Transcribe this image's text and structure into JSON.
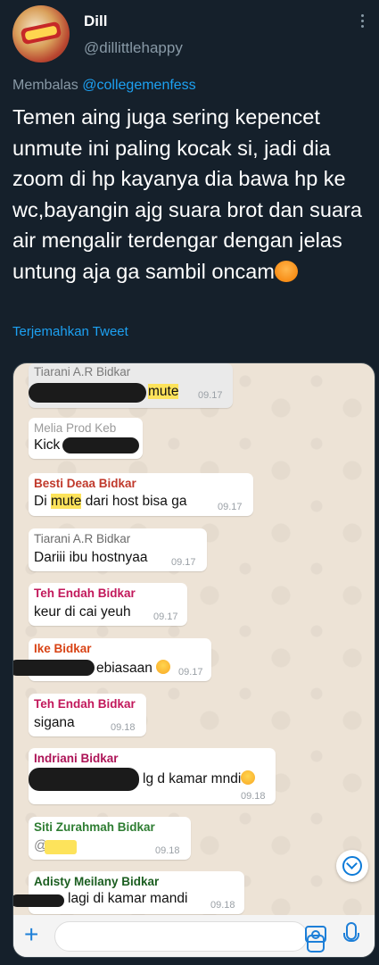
{
  "author": {
    "name": "Dill",
    "handle": "@dillittlehappy"
  },
  "reply": {
    "prefix": "Membalas",
    "mention": "@collegemenfess"
  },
  "tweet": {
    "text": "Temen aing juga sering kepencet unmute ini paling kocak si, jadi dia zoom di hp kayanya dia bawa hp ke wc,bayangin ajg suara brot dan suara air mengalir terdengar dengan jelas untung aja ga sambil oncam",
    "emoji": "tired-face-emoji"
  },
  "translate_label": "Terjemahkan Tweet",
  "chat": {
    "messages": [
      {
        "sender": "Tiarani A.R Bidkar",
        "sender_color": "#7a7a7a",
        "text": "mute",
        "time": "09.17"
      },
      {
        "sender": "Melia Prod Keb",
        "sender_color": "#9a9a9a",
        "text": "Kick",
        "time": ""
      },
      {
        "sender": "Besti Deaa Bidkar",
        "sender_color": "#c0392b",
        "text_before": "Di ",
        "text_hl": "mute",
        "text_after": " dari host bisa ga",
        "time": "09.17"
      },
      {
        "sender": "Tiarani A.R Bidkar",
        "sender_color": "#6b6b6b",
        "text": "Dariii ibu hostnyaa",
        "time": "09.17"
      },
      {
        "sender": "Teh Endah Bidkar",
        "sender_color": "#c2185b",
        "text": "keur di cai yeuh",
        "time": "09.17"
      },
      {
        "sender": "Ike Bidkar",
        "sender_color": "#d84315",
        "text": "ebiasaan",
        "time": "09.17"
      },
      {
        "sender": "Teh Endah Bidkar",
        "sender_color": "#c2185b",
        "text": "sigana",
        "time": "09.18"
      },
      {
        "sender": "Indriani Bidkar",
        "sender_color": "#ad1457",
        "text": "lg d kamar mndi",
        "time": "09.18"
      },
      {
        "sender": "Siti Zurahmah Bidkar",
        "sender_color": "#2e7d32",
        "text": "@",
        "time": "09.18"
      },
      {
        "sender": "Adisty Meilany Bidkar",
        "sender_color": "#1b5e20",
        "text": "lagi di kamar mandi",
        "time": "09.18"
      }
    ]
  },
  "colors": {
    "background": "#15202b",
    "link": "#1da1f2",
    "muted": "#8899a6",
    "chat_bg": "#ede3d6",
    "highlight": "#fde35b",
    "whatsapp_blue": "#1d7fd8"
  }
}
